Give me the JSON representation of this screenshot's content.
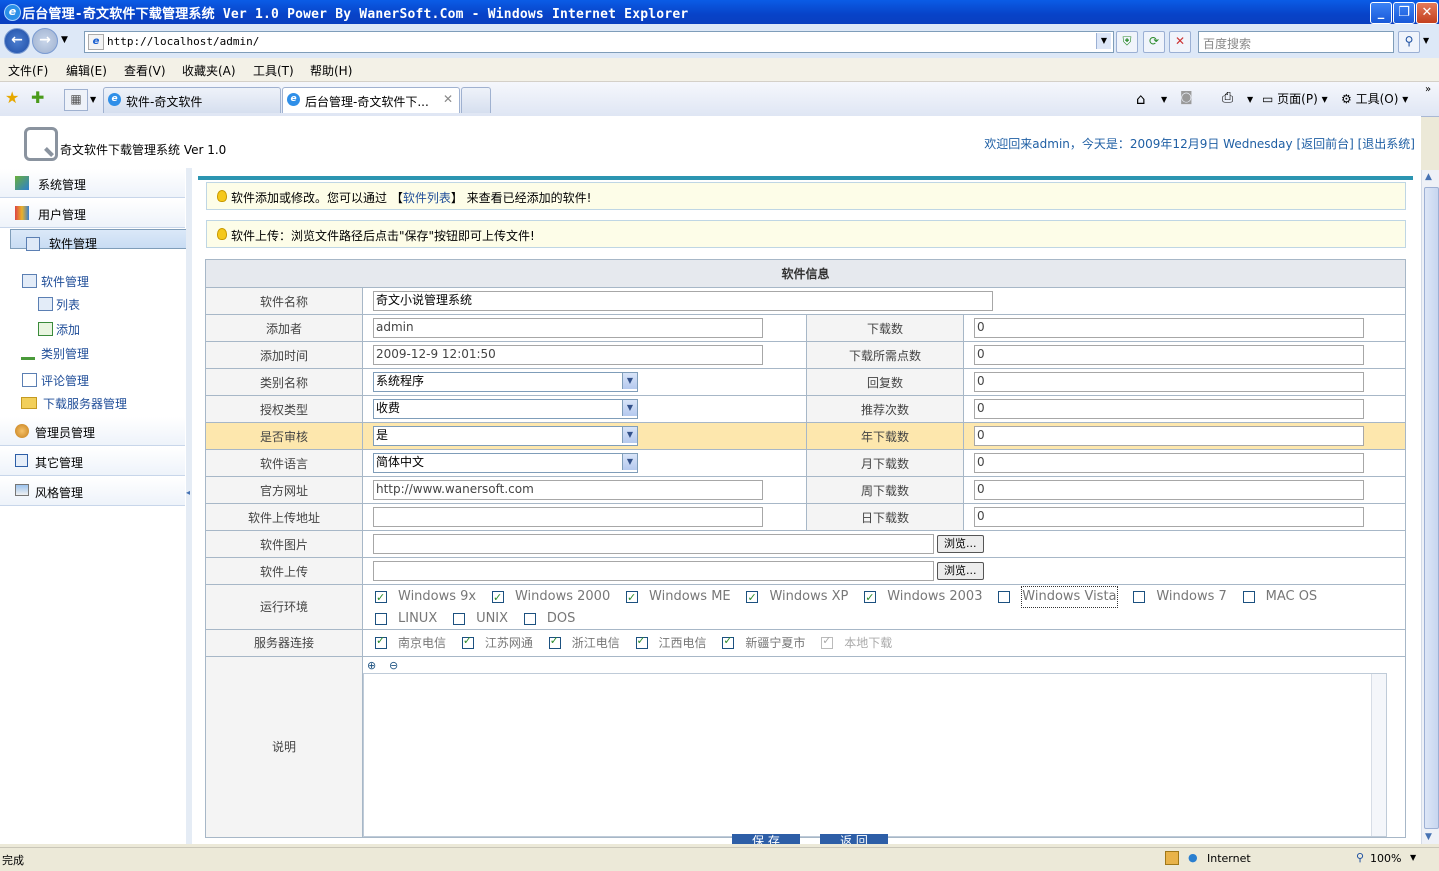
{
  "window": {
    "title": "后台管理-奇文软件下载管理系统 Ver 1.0 Power By WanerSoft.Com - Windows Internet Explorer"
  },
  "browser": {
    "url": "http://localhost/admin/",
    "search_placeholder": "百度搜索",
    "menu": [
      "文件(F)",
      "编辑(E)",
      "查看(V)",
      "收藏夹(A)",
      "工具(T)",
      "帮助(H)"
    ],
    "tabs": [
      {
        "label": "软件-奇文软件",
        "active": false
      },
      {
        "label": "后台管理-奇文软件下...",
        "active": true
      }
    ],
    "commands": {
      "page": "页面(P)",
      "tools": "工具(O)"
    },
    "status": {
      "text": "完成",
      "zone": "Internet",
      "zoom": "100%"
    }
  },
  "header": {
    "system_title": "奇文软件下载管理系统  Ver 1.0",
    "welcome": "欢迎回来admin，今天是：2009年12月9日 Wednesday  [返回前台]  [退出系统]"
  },
  "sidebar": {
    "sections": [
      {
        "label": "系统管理"
      },
      {
        "label": "用户管理"
      },
      {
        "label": "软件管理",
        "selected": true
      }
    ],
    "tree": {
      "root": "软件管理",
      "children": [
        "列表",
        "添加"
      ],
      "others": [
        "类别管理",
        "评论管理",
        "下载服务器管理"
      ]
    },
    "bottom_sections": [
      "管理员管理",
      "其它管理",
      "风格管理"
    ]
  },
  "notices": {
    "n1_pre": "软件添加或修改。您可以通过 【",
    "n1_link": "软件列表",
    "n1_post": "】 来查看已经添加的软件!",
    "n2": "软件上传：浏览文件路径后点击\"保存\"按钮即可上传文件!"
  },
  "form": {
    "header": "软件信息",
    "name_label": "软件名称",
    "name_value": "奇文小说管理系统",
    "adder_label": "添加者",
    "adder_value": "admin",
    "downloads_label": "下载数",
    "downloads_value": "0",
    "addtime_label": "添加时间",
    "addtime_value": "2009-12-9 12:01:50",
    "points_label": "下载所需点数",
    "points_value": "0",
    "category_label": "类别名称",
    "category_value": "系统程序",
    "replies_label": "回复数",
    "replies_value": "0",
    "license_label": "授权类型",
    "license_value": "收费",
    "recommend_label": "推荐次数",
    "recommend_value": "0",
    "audit_label": "是否审核",
    "audit_value": "是",
    "year_label": "年下载数",
    "year_value": "0",
    "lang_label": "软件语言",
    "lang_value": "简体中文",
    "month_label": "月下载数",
    "month_value": "0",
    "site_label": "官方网址",
    "site_value": "http://www.wanersoft.com",
    "week_label": "周下载数",
    "week_value": "0",
    "upurl_label": "软件上传地址",
    "upurl_value": "",
    "day_label": "日下载数",
    "day_value": "0",
    "image_label": "软件图片",
    "upload_label": "软件上传",
    "browse_label": "浏览...",
    "env_label": "运行环境",
    "env": [
      {
        "label": "Windows 9x",
        "checked": true
      },
      {
        "label": "Windows 2000",
        "checked": true
      },
      {
        "label": "Windows ME",
        "checked": true
      },
      {
        "label": "Windows XP",
        "checked": true
      },
      {
        "label": "Windows 2003",
        "checked": true
      },
      {
        "label": "Windows Vista",
        "checked": false
      },
      {
        "label": "Windows 7",
        "checked": false
      },
      {
        "label": "MAC OS",
        "checked": false
      },
      {
        "label": "LINUX",
        "checked": false
      },
      {
        "label": "UNIX",
        "checked": false
      },
      {
        "label": "DOS",
        "checked": false
      }
    ],
    "server_label": "服务器连接",
    "servers": [
      {
        "label": "南京电信",
        "checked": true
      },
      {
        "label": "江苏网通",
        "checked": true
      },
      {
        "label": "浙江电信",
        "checked": true
      },
      {
        "label": "江西电信",
        "checked": true
      },
      {
        "label": "新疆宁夏市",
        "checked": true
      },
      {
        "label": "本地下载",
        "checked": true,
        "disabled": true
      }
    ],
    "desc_label": "说明",
    "save_label": "保 存",
    "back_label": "返 回"
  }
}
